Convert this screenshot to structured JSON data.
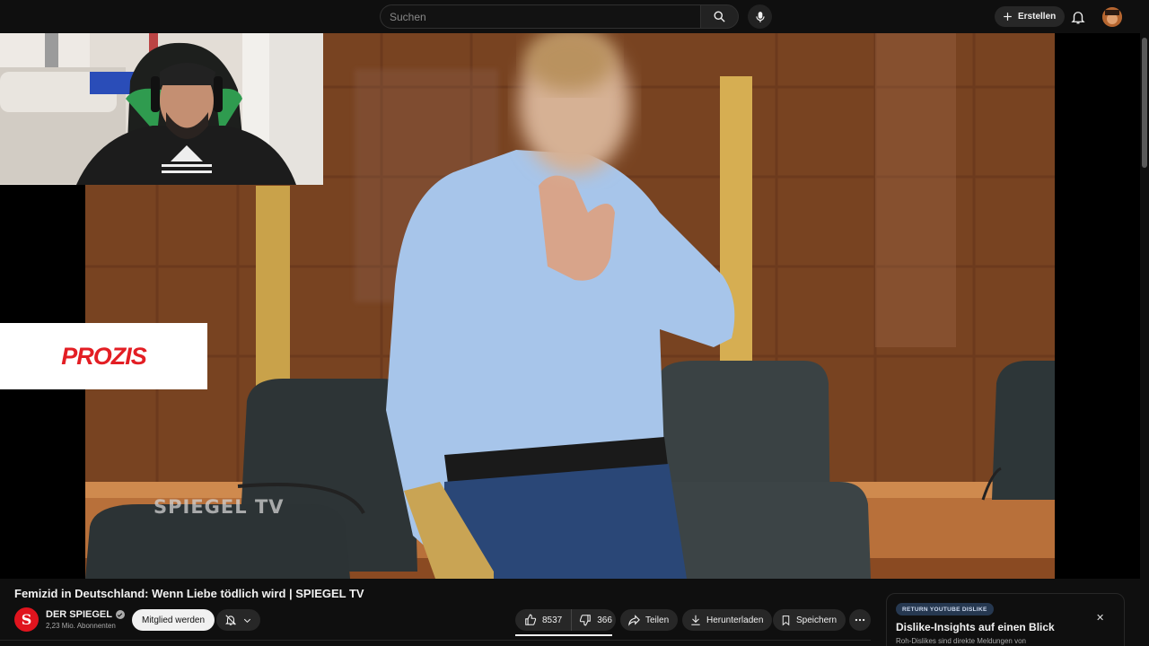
{
  "search": {
    "placeholder": "Suchen"
  },
  "header": {
    "create_label": "Erstellen"
  },
  "overlay": {
    "sponsor_logo": "PROZIS",
    "video_watermark": "SPIEGEL TV"
  },
  "video": {
    "title": "Femizid in Deutschland: Wenn Liebe tödlich wird | SPIEGEL TV",
    "channel": {
      "name": "DER SPIEGEL",
      "subscribers": "2,23 Mio. Abonnenten",
      "avatar_letter": "S"
    },
    "join_label": "Mitglied werden",
    "actions": {
      "likes": "8537",
      "dislikes": "366",
      "share": "Teilen",
      "download": "Herunterladen",
      "save": "Speichern"
    }
  },
  "dislike_card": {
    "badge": "RETURN YOUTUBE DISLIKE",
    "title": "Dislike-Insights auf einen Blick",
    "subtitle": "Roh-Dislikes sind direkte Meldungen von"
  },
  "colors": {
    "background": "#0f0f0f",
    "pill": "#272727",
    "channel_red": "#e0141e",
    "prozis_red": "#e31e24"
  },
  "icons": [
    "search-icon",
    "mic-icon",
    "plus-icon",
    "bell-icon",
    "verified-icon",
    "bell-off-icon",
    "chevron-down-icon",
    "thumbs-up-icon",
    "thumbs-down-icon",
    "share-icon",
    "download-icon",
    "bookmark-icon",
    "more-icon",
    "close-icon"
  ]
}
